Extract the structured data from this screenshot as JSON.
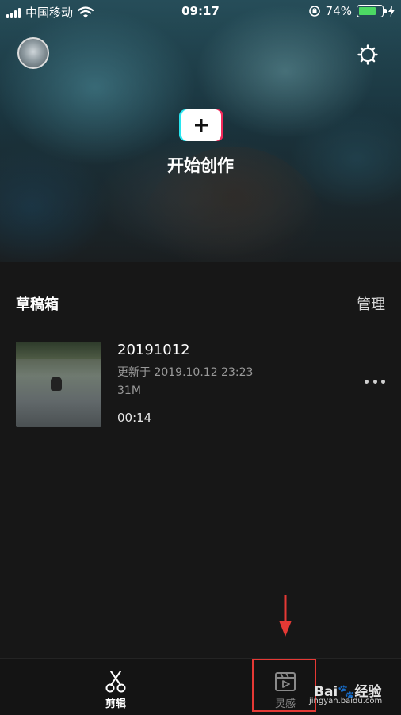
{
  "status_bar": {
    "carrier": "中国移动",
    "time": "09:17",
    "battery": "74%"
  },
  "hero": {
    "create_label": "开始创作"
  },
  "drafts": {
    "title": "草稿箱",
    "manage": "管理",
    "items": [
      {
        "name": "20191012",
        "updated": "更新于 2019.10.12 23:23",
        "size": "31M",
        "duration": "00:14"
      }
    ]
  },
  "bottom_nav": {
    "items": [
      {
        "label": "剪辑",
        "icon": "scissors-icon",
        "active": true
      },
      {
        "label": "灵感",
        "icon": "clapperboard-icon",
        "active": false
      }
    ]
  },
  "watermark": {
    "brand": "Bai",
    "brand_tail": "经验",
    "url": "jingyan.baidu.com"
  },
  "colors": {
    "background": "#171717",
    "accent_cyan": "#28e6f0",
    "accent_pink": "#f1295b",
    "battery_green": "#4cd964",
    "annotation_red": "#e53935"
  }
}
